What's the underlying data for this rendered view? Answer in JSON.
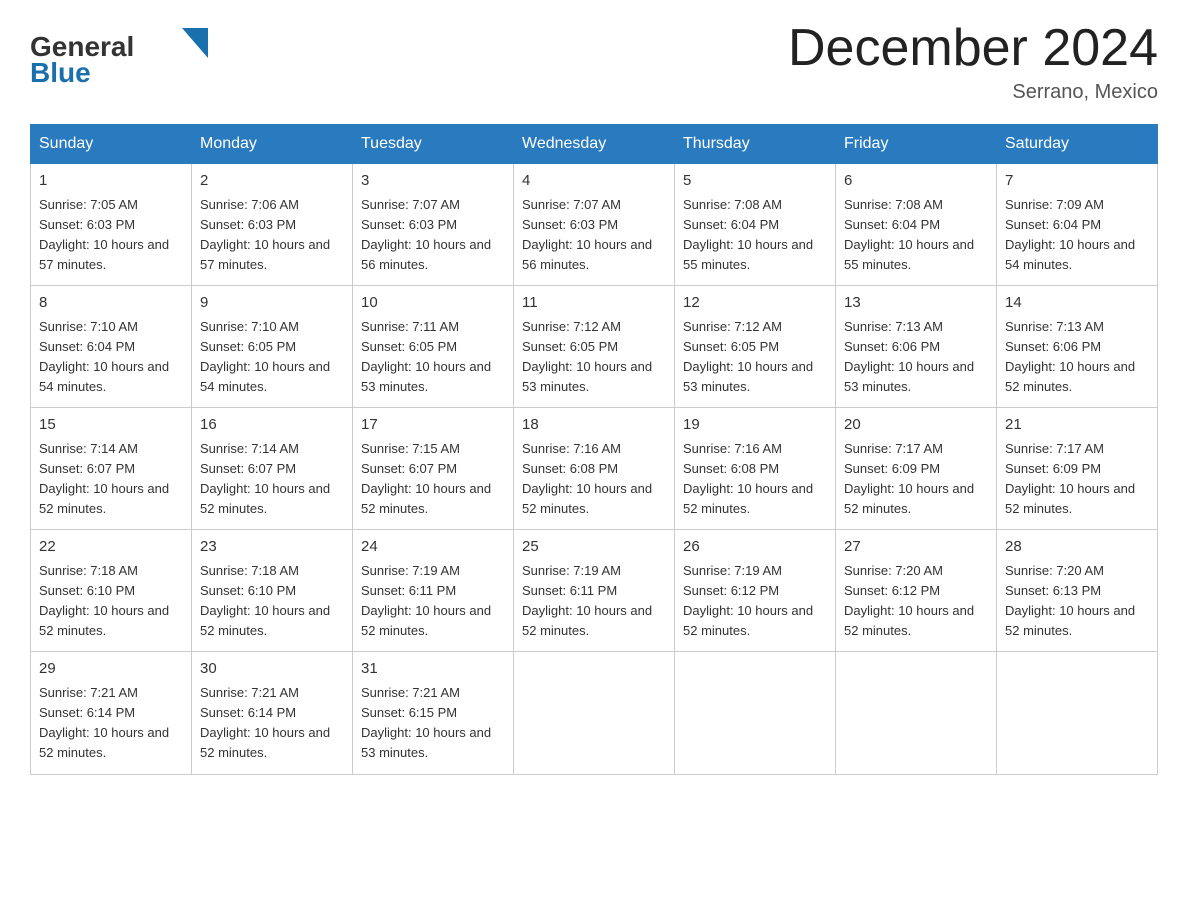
{
  "header": {
    "logo_general": "General",
    "logo_blue": "Blue",
    "month_title": "December 2024",
    "location": "Serrano, Mexico"
  },
  "days_of_week": [
    "Sunday",
    "Monday",
    "Tuesday",
    "Wednesday",
    "Thursday",
    "Friday",
    "Saturday"
  ],
  "weeks": [
    [
      {
        "day": "1",
        "sunrise": "7:05 AM",
        "sunset": "6:03 PM",
        "daylight": "10 hours and 57 minutes."
      },
      {
        "day": "2",
        "sunrise": "7:06 AM",
        "sunset": "6:03 PM",
        "daylight": "10 hours and 57 minutes."
      },
      {
        "day": "3",
        "sunrise": "7:07 AM",
        "sunset": "6:03 PM",
        "daylight": "10 hours and 56 minutes."
      },
      {
        "day": "4",
        "sunrise": "7:07 AM",
        "sunset": "6:03 PM",
        "daylight": "10 hours and 56 minutes."
      },
      {
        "day": "5",
        "sunrise": "7:08 AM",
        "sunset": "6:04 PM",
        "daylight": "10 hours and 55 minutes."
      },
      {
        "day": "6",
        "sunrise": "7:08 AM",
        "sunset": "6:04 PM",
        "daylight": "10 hours and 55 minutes."
      },
      {
        "day": "7",
        "sunrise": "7:09 AM",
        "sunset": "6:04 PM",
        "daylight": "10 hours and 54 minutes."
      }
    ],
    [
      {
        "day": "8",
        "sunrise": "7:10 AM",
        "sunset": "6:04 PM",
        "daylight": "10 hours and 54 minutes."
      },
      {
        "day": "9",
        "sunrise": "7:10 AM",
        "sunset": "6:05 PM",
        "daylight": "10 hours and 54 minutes."
      },
      {
        "day": "10",
        "sunrise": "7:11 AM",
        "sunset": "6:05 PM",
        "daylight": "10 hours and 53 minutes."
      },
      {
        "day": "11",
        "sunrise": "7:12 AM",
        "sunset": "6:05 PM",
        "daylight": "10 hours and 53 minutes."
      },
      {
        "day": "12",
        "sunrise": "7:12 AM",
        "sunset": "6:05 PM",
        "daylight": "10 hours and 53 minutes."
      },
      {
        "day": "13",
        "sunrise": "7:13 AM",
        "sunset": "6:06 PM",
        "daylight": "10 hours and 53 minutes."
      },
      {
        "day": "14",
        "sunrise": "7:13 AM",
        "sunset": "6:06 PM",
        "daylight": "10 hours and 52 minutes."
      }
    ],
    [
      {
        "day": "15",
        "sunrise": "7:14 AM",
        "sunset": "6:07 PM",
        "daylight": "10 hours and 52 minutes."
      },
      {
        "day": "16",
        "sunrise": "7:14 AM",
        "sunset": "6:07 PM",
        "daylight": "10 hours and 52 minutes."
      },
      {
        "day": "17",
        "sunrise": "7:15 AM",
        "sunset": "6:07 PM",
        "daylight": "10 hours and 52 minutes."
      },
      {
        "day": "18",
        "sunrise": "7:16 AM",
        "sunset": "6:08 PM",
        "daylight": "10 hours and 52 minutes."
      },
      {
        "day": "19",
        "sunrise": "7:16 AM",
        "sunset": "6:08 PM",
        "daylight": "10 hours and 52 minutes."
      },
      {
        "day": "20",
        "sunrise": "7:17 AM",
        "sunset": "6:09 PM",
        "daylight": "10 hours and 52 minutes."
      },
      {
        "day": "21",
        "sunrise": "7:17 AM",
        "sunset": "6:09 PM",
        "daylight": "10 hours and 52 minutes."
      }
    ],
    [
      {
        "day": "22",
        "sunrise": "7:18 AM",
        "sunset": "6:10 PM",
        "daylight": "10 hours and 52 minutes."
      },
      {
        "day": "23",
        "sunrise": "7:18 AM",
        "sunset": "6:10 PM",
        "daylight": "10 hours and 52 minutes."
      },
      {
        "day": "24",
        "sunrise": "7:19 AM",
        "sunset": "6:11 PM",
        "daylight": "10 hours and 52 minutes."
      },
      {
        "day": "25",
        "sunrise": "7:19 AM",
        "sunset": "6:11 PM",
        "daylight": "10 hours and 52 minutes."
      },
      {
        "day": "26",
        "sunrise": "7:19 AM",
        "sunset": "6:12 PM",
        "daylight": "10 hours and 52 minutes."
      },
      {
        "day": "27",
        "sunrise": "7:20 AM",
        "sunset": "6:12 PM",
        "daylight": "10 hours and 52 minutes."
      },
      {
        "day": "28",
        "sunrise": "7:20 AM",
        "sunset": "6:13 PM",
        "daylight": "10 hours and 52 minutes."
      }
    ],
    [
      {
        "day": "29",
        "sunrise": "7:21 AM",
        "sunset": "6:14 PM",
        "daylight": "10 hours and 52 minutes."
      },
      {
        "day": "30",
        "sunrise": "7:21 AM",
        "sunset": "6:14 PM",
        "daylight": "10 hours and 52 minutes."
      },
      {
        "day": "31",
        "sunrise": "7:21 AM",
        "sunset": "6:15 PM",
        "daylight": "10 hours and 53 minutes."
      },
      null,
      null,
      null,
      null
    ]
  ],
  "labels": {
    "sunrise_prefix": "Sunrise: ",
    "sunset_prefix": "Sunset: ",
    "daylight_prefix": "Daylight: "
  }
}
